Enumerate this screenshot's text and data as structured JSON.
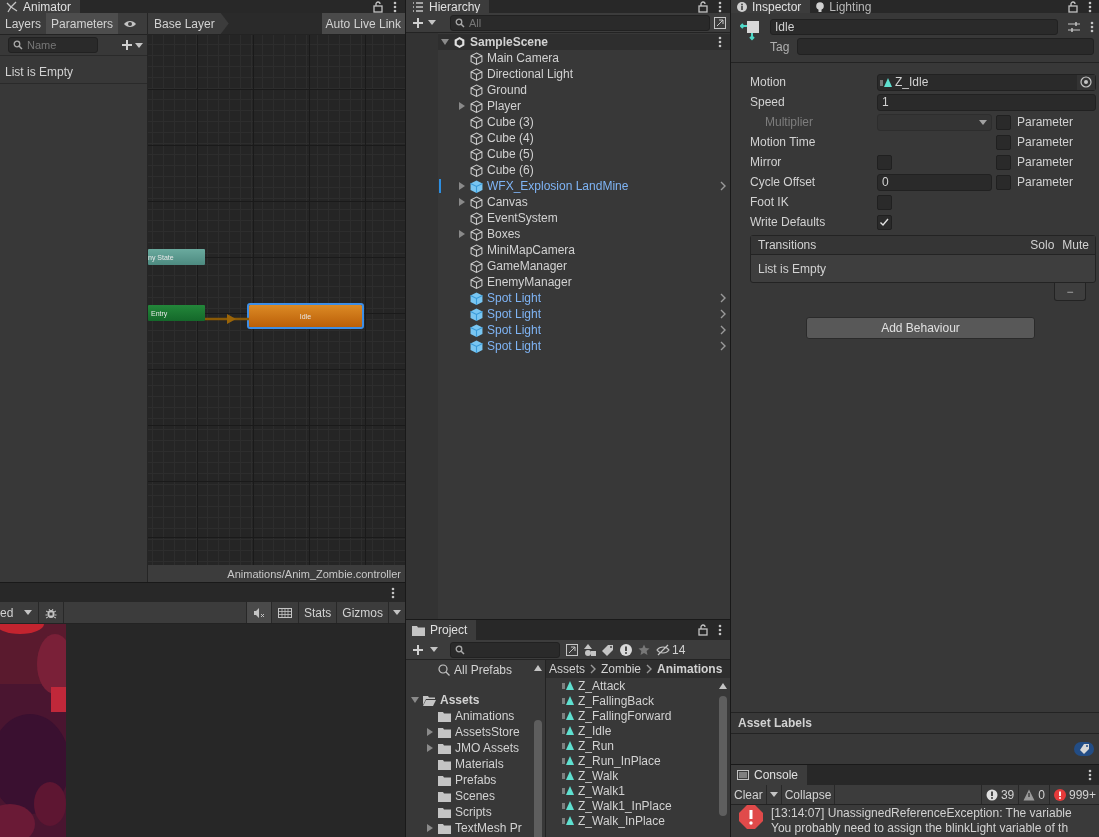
{
  "animator": {
    "title": "Animator",
    "tabs": [
      {
        "label": "Layers",
        "selected": false
      },
      {
        "label": "Parameters",
        "selected": true
      }
    ],
    "search": {
      "placeholder": "Name"
    },
    "parameters_empty": "List is Empty",
    "breadcrumb": "Base Layer",
    "live_link_button": "Auto Live Link",
    "nodes": [
      {
        "label": "ny State",
        "kind": "any",
        "selected": false
      },
      {
        "label": "Entry",
        "kind": "entry",
        "selected": false
      },
      {
        "label": "Idle",
        "kind": "state",
        "selected": true
      }
    ],
    "footer_path": "Animations/Anim_Zombie.controller"
  },
  "game_view": {
    "dropdown": "ed",
    "stats_button": "Stats",
    "gizmos_button": "Gizmos"
  },
  "hierarchy": {
    "title": "Hierarchy",
    "search": {
      "placeholder": "All"
    },
    "scene": {
      "name": "SampleScene",
      "expanded": true
    },
    "items": [
      {
        "name": "Main Camera",
        "kind": "object",
        "expandable": false
      },
      {
        "name": "Directional Light",
        "kind": "object",
        "expandable": false
      },
      {
        "name": "Ground",
        "kind": "object",
        "expandable": false
      },
      {
        "name": "Player",
        "kind": "object",
        "expandable": true
      },
      {
        "name": "Cube (3)",
        "kind": "object",
        "expandable": false
      },
      {
        "name": "Cube (4)",
        "kind": "object",
        "expandable": false
      },
      {
        "name": "Cube (5)",
        "kind": "object",
        "expandable": false
      },
      {
        "name": "Cube (6)",
        "kind": "object",
        "expandable": false
      },
      {
        "name": "WFX_Explosion LandMine",
        "kind": "prefab",
        "expandable": true,
        "marked": true
      },
      {
        "name": "Canvas",
        "kind": "object",
        "expandable": true
      },
      {
        "name": "EventSystem",
        "kind": "object",
        "expandable": false
      },
      {
        "name": "Boxes",
        "kind": "object",
        "expandable": true
      },
      {
        "name": "MiniMapCamera",
        "kind": "object",
        "expandable": false
      },
      {
        "name": "GameManager",
        "kind": "object",
        "expandable": false
      },
      {
        "name": "EnemyManager",
        "kind": "object",
        "expandable": false
      },
      {
        "name": "Spot Light",
        "kind": "prefab",
        "expandable": false
      },
      {
        "name": "Spot Light",
        "kind": "prefab",
        "expandable": false
      },
      {
        "name": "Spot Light",
        "kind": "prefab",
        "expandable": false
      },
      {
        "name": "Spot Light",
        "kind": "prefab",
        "expandable": false
      }
    ]
  },
  "project": {
    "title": "Project",
    "hidden_count": "14",
    "favorites": "All Prefabs",
    "tree": {
      "name": "Assets",
      "expanded": true,
      "children": [
        {
          "name": "Animations",
          "expandable": false
        },
        {
          "name": "AssetsStore",
          "expandable": true
        },
        {
          "name": "JMO Assets",
          "expandable": true
        },
        {
          "name": "Materials",
          "expandable": false
        },
        {
          "name": "Prefabs",
          "expandable": false
        },
        {
          "name": "Scenes",
          "expandable": false
        },
        {
          "name": "Scripts",
          "expandable": false
        },
        {
          "name": "TextMesh Pr",
          "expandable": true
        }
      ]
    },
    "breadcrumb": [
      "Assets",
      "Zombie",
      "Animations"
    ],
    "files": [
      "Z_Attack",
      "Z_FallingBack",
      "Z_FallingForward",
      "Z_Idle",
      "Z_Run",
      "Z_Run_InPlace",
      "Z_Walk",
      "Z_Walk1",
      "Z_Walk1_InPlace",
      "Z_Walk_InPlace"
    ]
  },
  "inspector": {
    "tabs": [
      {
        "label": "Inspector",
        "selected": true
      },
      {
        "label": "Lighting",
        "selected": false
      }
    ],
    "name": "Idle",
    "tag_label": "Tag",
    "fields": [
      {
        "label": "Motion",
        "kind": "object",
        "value": "Z_Idle"
      },
      {
        "label": "Speed",
        "kind": "text",
        "value": "1"
      },
      {
        "label": "Multiplier",
        "kind": "dropdown",
        "disabled": true,
        "parameter": {
          "label": "Parameter",
          "checked": false
        }
      },
      {
        "label": "Motion Time",
        "kind": "none",
        "parameter": {
          "label": "Parameter",
          "checked": false
        }
      },
      {
        "label": "Mirror",
        "kind": "checkbox",
        "checked": false,
        "parameter": {
          "label": "Parameter",
          "checked": false
        }
      },
      {
        "label": "Cycle Offset",
        "kind": "text",
        "value": "0",
        "parameter": {
          "label": "Parameter",
          "checked": false
        }
      },
      {
        "label": "Foot IK",
        "kind": "checkbox",
        "checked": false
      },
      {
        "label": "Write Defaults",
        "kind": "checkbox",
        "checked": true
      }
    ],
    "transitions": {
      "title": "Transitions",
      "columns": [
        "Solo",
        "Mute"
      ],
      "empty": "List is Empty",
      "remove_button": "−"
    },
    "add_button": "Add Behaviour",
    "asset_labels": "Asset Labels"
  },
  "console": {
    "title": "Console",
    "clear_button": "Clear",
    "collapse_button": "Collapse",
    "info_count": "39",
    "warning_count": "0",
    "error_count": "999+",
    "message": [
      "[13:14:07] UnassignedReferenceException: The variable",
      "You probably need to assign the blinkLight variable of th"
    ]
  }
}
